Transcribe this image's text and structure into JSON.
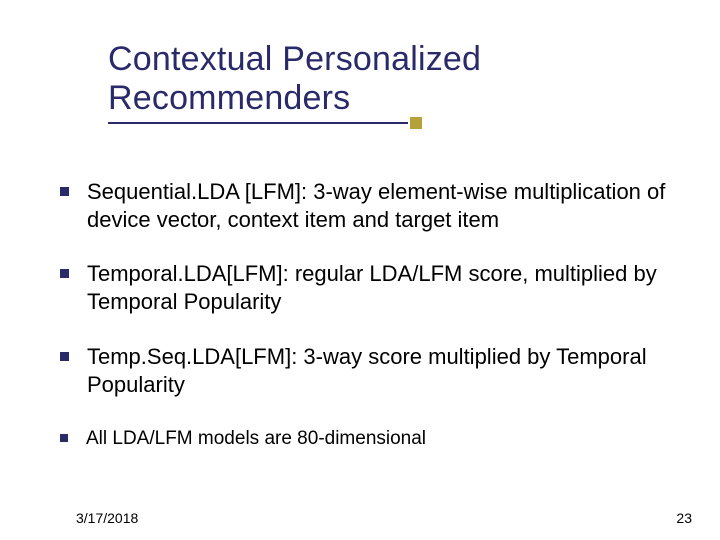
{
  "title": "Contextual Personalized Recommenders",
  "bullets": [
    {
      "text": "Sequential.LDA [LFM]: 3-way element-wise multiplication of device vector, context item and target item",
      "size": "normal"
    },
    {
      "text": "Temporal.LDA[LFM]: regular LDA/LFM score, multiplied by Temporal Popularity",
      "size": "normal"
    },
    {
      "text": "Temp.Seq.LDA[LFM]: 3-way score multiplied by Temporal Popularity",
      "size": "normal"
    },
    {
      "text": "All LDA/LFM models are 80-dimensional",
      "size": "small"
    }
  ],
  "footer": {
    "date": "3/17/2018",
    "page": "23"
  }
}
